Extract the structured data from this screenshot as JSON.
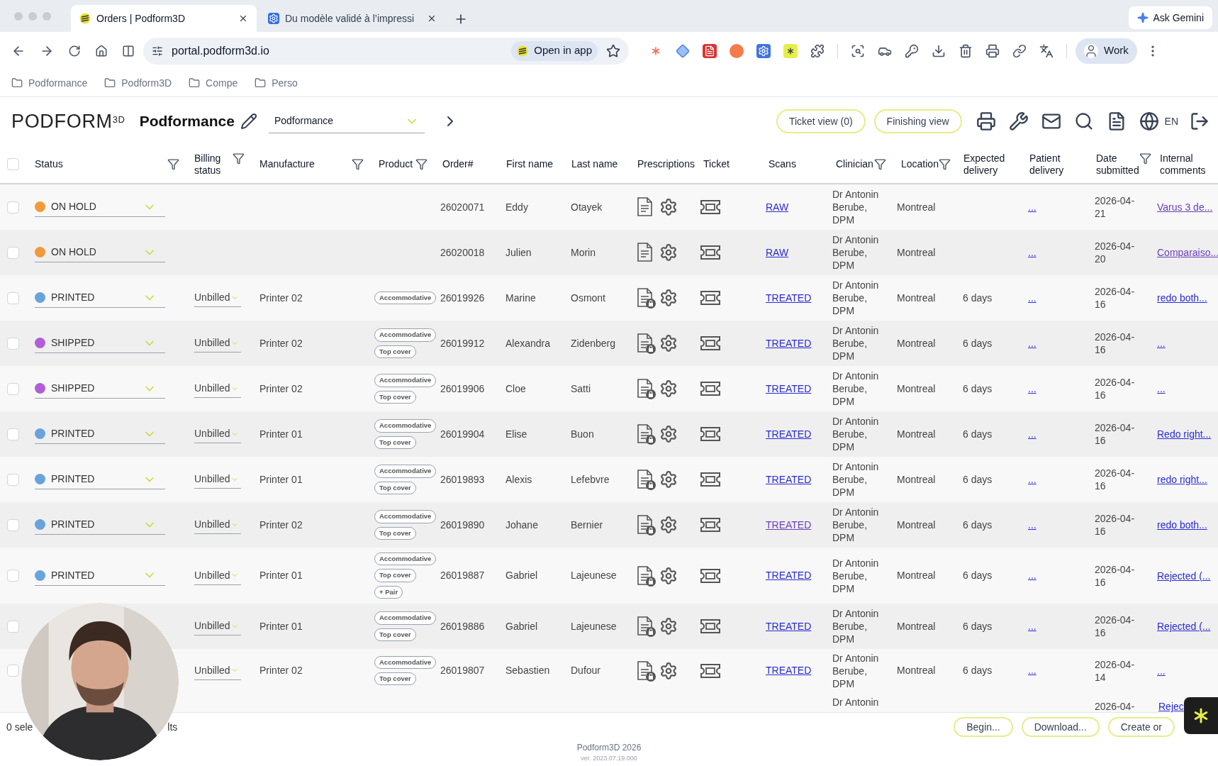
{
  "browser": {
    "tabs": [
      {
        "title": "Orders | Podform3D",
        "selected": true
      },
      {
        "title": "Du modèle validé à l’impressi",
        "selected": false
      }
    ],
    "ask_button": "Ask Gemini",
    "url": "portal.podform3d.io",
    "open_in_app": "Open in app",
    "profile": "Work",
    "bookmarks": [
      "Podformance",
      "Podform3D",
      "Compe",
      "Perso"
    ]
  },
  "header": {
    "logo": "PODFORM$^{3D}$",
    "title": "Podformance",
    "workspace_select": "Podformance",
    "buttons": [
      "Ticket view (0)",
      "Finishing view"
    ],
    "language": "EN"
  },
  "table": {
    "select_all": {
      "checked": false
    },
    "columns": [
      {
        "label": "Status",
        "filter": true
      },
      {
        "label": "Billing status",
        "filter": true
      },
      {
        "label": "Manufacture",
        "filter": true
      },
      {
        "label": "Product",
        "filter": true
      },
      {
        "label": "Order#",
        "filter": false
      },
      {
        "label": "First name",
        "filter": false
      },
      {
        "label": "Last name",
        "filter": false
      },
      {
        "label": "Prescriptions",
        "filter": false
      },
      {
        "label": "Ticket",
        "filter": false
      },
      {
        "label": "Scans",
        "filter": false
      },
      {
        "label": "Clinician",
        "filter": true
      },
      {
        "label": "Location",
        "filter": true
      },
      {
        "label": "Expected delivery",
        "filter": false
      },
      {
        "label": "Patient delivery",
        "filter": false
      },
      {
        "label": "Date submitted",
        "filter": true
      },
      {
        "label": "Internal comments",
        "filter": false
      }
    ],
    "rows": [
      {
        "checked": false,
        "status": {
          "label": "ON HOLD",
          "color": "#f09a3a"
        },
        "order": "26020071",
        "first_name": "Eddy",
        "last_name": "Otayek",
        "prescription_locked": false,
        "scans": {
          "label": "RAW",
          "visited": false
        },
        "clinician": "Dr Antonin Berube, DPM",
        "location": "Montreal",
        "patient_delivery": "...",
        "date": "2026-04-21",
        "comment": {
          "label": "Varus 3 de...",
          "visited": true
        }
      },
      {
        "checked": false,
        "status": {
          "label": "ON HOLD",
          "color": "#f09a3a"
        },
        "order": "26020018",
        "first_name": "Julien",
        "last_name": "Morin",
        "prescription_locked": false,
        "scans": {
          "label": "RAW",
          "visited": false
        },
        "clinician": "Dr Antonin Berube, DPM",
        "location": "Montreal",
        "patient_delivery": "...",
        "date": "2026-04-20",
        "comment": {
          "label": "Comparaiso...",
          "visited": true
        }
      },
      {
        "checked": false,
        "status": {
          "label": "PRINTED",
          "color": "#6aa3dc"
        },
        "billing": "Unbilled",
        "manufacture": "Printer 02",
        "products": [
          "Accommodative"
        ],
        "order": "26019926",
        "first_name": "Marine",
        "last_name": "Osmont",
        "prescription_locked": true,
        "scans": {
          "label": "TREATED",
          "visited": false
        },
        "clinician": "Dr Antonin Berube, DPM",
        "location": "Montreal",
        "expected": "6 days",
        "patient_delivery": "...",
        "date": "2026-04-16",
        "comment": {
          "label": "redo both...",
          "visited": false
        }
      },
      {
        "checked": false,
        "status": {
          "label": "SHIPPED",
          "color": "#b25ed8"
        },
        "billing": "Unbilled",
        "manufacture": "Printer 02",
        "products": [
          "Accommodative",
          "Top cover"
        ],
        "order": "26019912",
        "first_name": "Alexandra",
        "last_name": "Zidenberg",
        "prescription_locked": true,
        "scans": {
          "label": "TREATED",
          "visited": false
        },
        "clinician": "Dr Antonin Berube, DPM",
        "location": "Montreal",
        "expected": "6 days",
        "patient_delivery": "...",
        "date": "2026-04-16",
        "comment": {
          "label": "...",
          "visited": false
        }
      },
      {
        "checked": false,
        "status": {
          "label": "SHIPPED",
          "color": "#b25ed8"
        },
        "billing": "Unbilled",
        "manufacture": "Printer 02",
        "products": [
          "Accommodative",
          "Top cover"
        ],
        "order": "26019906",
        "first_name": "Cloe",
        "last_name": "Satti",
        "prescription_locked": true,
        "scans": {
          "label": "TREATED",
          "visited": false
        },
        "clinician": "Dr Antonin Berube, DPM",
        "location": "Montreal",
        "expected": "6 days",
        "patient_delivery": "...",
        "date": "2026-04-16",
        "comment": {
          "label": "...",
          "visited": false
        }
      },
      {
        "checked": false,
        "status": {
          "label": "PRINTED",
          "color": "#6aa3dc"
        },
        "billing": "Unbilled",
        "manufacture": "Printer 01",
        "products": [
          "Accommodative",
          "Top cover"
        ],
        "order": "26019904",
        "first_name": "Elise",
        "last_name": "Buon",
        "prescription_locked": true,
        "scans": {
          "label": "TREATED",
          "visited": false
        },
        "clinician": "Dr Antonin Berube, DPM",
        "location": "Montreal",
        "expected": "6 days",
        "patient_delivery": "...",
        "date": "2026-04-16",
        "comment": {
          "label": "Redo right...",
          "visited": false
        }
      },
      {
        "checked": false,
        "status": {
          "label": "PRINTED",
          "color": "#6aa3dc"
        },
        "billing": "Unbilled",
        "manufacture": "Printer 01",
        "products": [
          "Accommodative",
          "Top cover"
        ],
        "order": "26019893",
        "first_name": "Alexis",
        "last_name": "Lefebvre",
        "prescription_locked": true,
        "scans": {
          "label": "TREATED",
          "visited": false
        },
        "clinician": "Dr Antonin Berube, DPM",
        "location": "Montreal",
        "expected": "6 days",
        "patient_delivery": "...",
        "date": "2026-04-16",
        "comment": {
          "label": "redo right...",
          "visited": false
        }
      },
      {
        "checked": false,
        "status": {
          "label": "PRINTED",
          "color": "#6aa3dc"
        },
        "billing": "Unbilled",
        "manufacture": "Printer 02",
        "products": [
          "Accommodative",
          "Top cover"
        ],
        "order": "26019890",
        "first_name": "Johane",
        "last_name": "Bernier",
        "prescription_locked": true,
        "scans": {
          "label": "TREATED",
          "visited": true
        },
        "clinician": "Dr Antonin Berube, DPM",
        "location": "Montreal",
        "expected": "6 days",
        "patient_delivery": "...",
        "date": "2026-04-16",
        "comment": {
          "label": "redo both...",
          "visited": false
        }
      },
      {
        "checked": false,
        "status": {
          "label": "PRINTED",
          "color": "#6aa3dc"
        },
        "billing": "Unbilled",
        "manufacture": "Printer 01",
        "products": [
          "Accommodative",
          "Top cover",
          "+ Pair"
        ],
        "order": "26019887",
        "first_name": "Gabriel",
        "last_name": "Lajeunese",
        "prescription_locked": true,
        "scans": {
          "label": "TREATED",
          "visited": false
        },
        "clinician": "Dr Antonin Berube, DPM",
        "location": "Montreal",
        "expected": "6 days",
        "patient_delivery": "...",
        "date": "2026-04-16",
        "comment": {
          "label": "Rejected (...",
          "visited": false
        }
      },
      {
        "checked": false,
        "billing": "Unbilled",
        "manufacture": "Printer 01",
        "products": [
          "Accommodative",
          "Top cover"
        ],
        "order": "26019886",
        "first_name": "Gabriel",
        "last_name": "Lajeunese",
        "prescription_locked": true,
        "scans": {
          "label": "TREATED",
          "visited": false
        },
        "clinician": "Dr Antonin Berube, DPM",
        "location": "Montreal",
        "expected": "6 days",
        "patient_delivery": "...",
        "date": "2026-04-16",
        "comment": {
          "label": "Rejected (...",
          "visited": false
        }
      },
      {
        "checked": false,
        "billing": "Unbilled",
        "manufacture": "Printer 02",
        "products": [
          "Accommodative",
          "Top cover"
        ],
        "order": "26019807",
        "first_name": "Sebastien",
        "last_name": "Dufour",
        "prescription_locked": true,
        "scans": {
          "label": "TREATED",
          "visited": false
        },
        "clinician": "Dr Antonin Berube, DPM",
        "location": "Montreal",
        "expected": "6 days",
        "patient_delivery": "...",
        "date": "2026-04-14",
        "comment": {
          "label": "...",
          "visited": false
        }
      }
    ],
    "partial_row": {
      "clinician": "Dr Antonin",
      "date": "2026-04-",
      "comment": "Rejec"
    }
  },
  "footer": {
    "selection_start": "0 sele",
    "selection_end": "lts",
    "buttons": [
      "Begin...",
      "Download...",
      "Create or"
    ],
    "copyright": "Podform3D 2026",
    "version": "ver. 2023.07.19.000"
  }
}
